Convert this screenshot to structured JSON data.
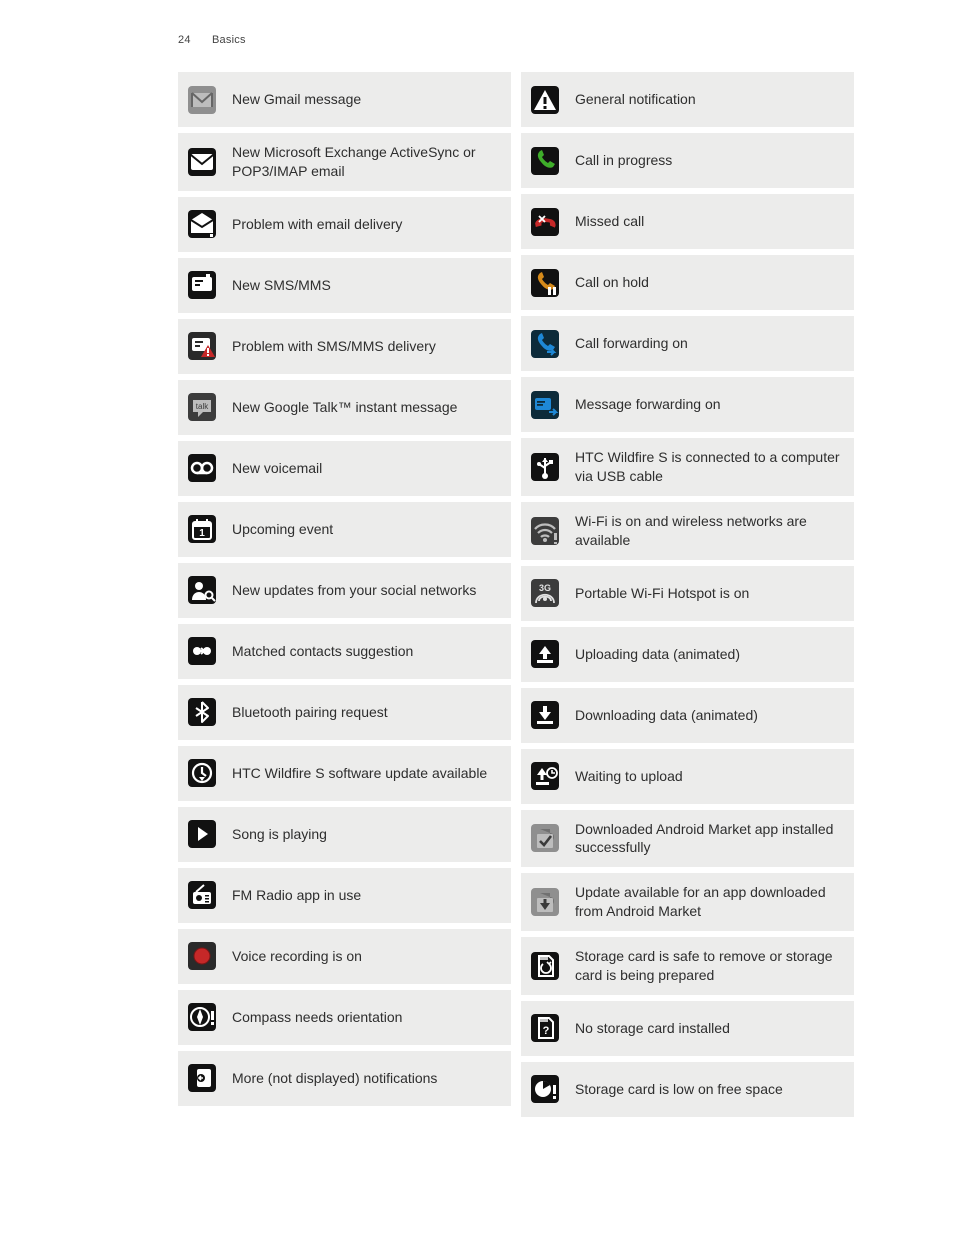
{
  "page_number": "24",
  "section": "Basics",
  "left": [
    {
      "id": "gmail",
      "label": "New Gmail message"
    },
    {
      "id": "exchange",
      "label": "New Microsoft Exchange ActiveSync or POP3/IMAP email"
    },
    {
      "id": "mail-problem",
      "label": "Problem with email delivery"
    },
    {
      "id": "sms",
      "label": "New SMS/MMS"
    },
    {
      "id": "sms-problem",
      "label": "Problem with SMS/MMS delivery"
    },
    {
      "id": "gtalk",
      "label": "New Google Talk™ instant message"
    },
    {
      "id": "voicemail",
      "label": "New voicemail"
    },
    {
      "id": "event",
      "label": "Upcoming event"
    },
    {
      "id": "social",
      "label": "New updates from your social networks"
    },
    {
      "id": "contacts",
      "label": "Matched contacts suggestion"
    },
    {
      "id": "bluetooth",
      "label": "Bluetooth pairing request"
    },
    {
      "id": "sw-update",
      "label": "HTC Wildfire S software update available"
    },
    {
      "id": "song",
      "label": "Song is playing"
    },
    {
      "id": "fm",
      "label": "FM Radio app in use"
    },
    {
      "id": "voice-rec",
      "label": "Voice recording is on"
    },
    {
      "id": "compass",
      "label": "Compass needs orientation"
    },
    {
      "id": "more",
      "label": "More (not displayed) notifications"
    }
  ],
  "right": [
    {
      "id": "general",
      "label": "General notification"
    },
    {
      "id": "call-prog",
      "label": "Call in progress"
    },
    {
      "id": "missed",
      "label": "Missed call"
    },
    {
      "id": "hold",
      "label": "Call on hold"
    },
    {
      "id": "call-fwd",
      "label": "Call forwarding on"
    },
    {
      "id": "msg-fwd",
      "label": "Message forwarding on"
    },
    {
      "id": "usb",
      "label": "HTC Wildfire S is connected to a computer via USB cable"
    },
    {
      "id": "wifi",
      "label": "Wi-Fi is on and wireless networks are available"
    },
    {
      "id": "hotspot",
      "label": "Portable Wi-Fi Hotspot is on"
    },
    {
      "id": "upload",
      "label": "Uploading data (animated)"
    },
    {
      "id": "download",
      "label": "Downloading data (animated)"
    },
    {
      "id": "wait-up",
      "label": "Waiting to upload"
    },
    {
      "id": "dl-ok",
      "label": "Downloaded Android Market app installed successfully"
    },
    {
      "id": "dl-update",
      "label": "Update available for an app downloaded from Android Market"
    },
    {
      "id": "sd-safe",
      "label": "Storage card is safe to remove or storage card is being prepared"
    },
    {
      "id": "sd-none",
      "label": "No storage card installed"
    },
    {
      "id": "sd-low",
      "label": "Storage card is low on free space"
    }
  ]
}
